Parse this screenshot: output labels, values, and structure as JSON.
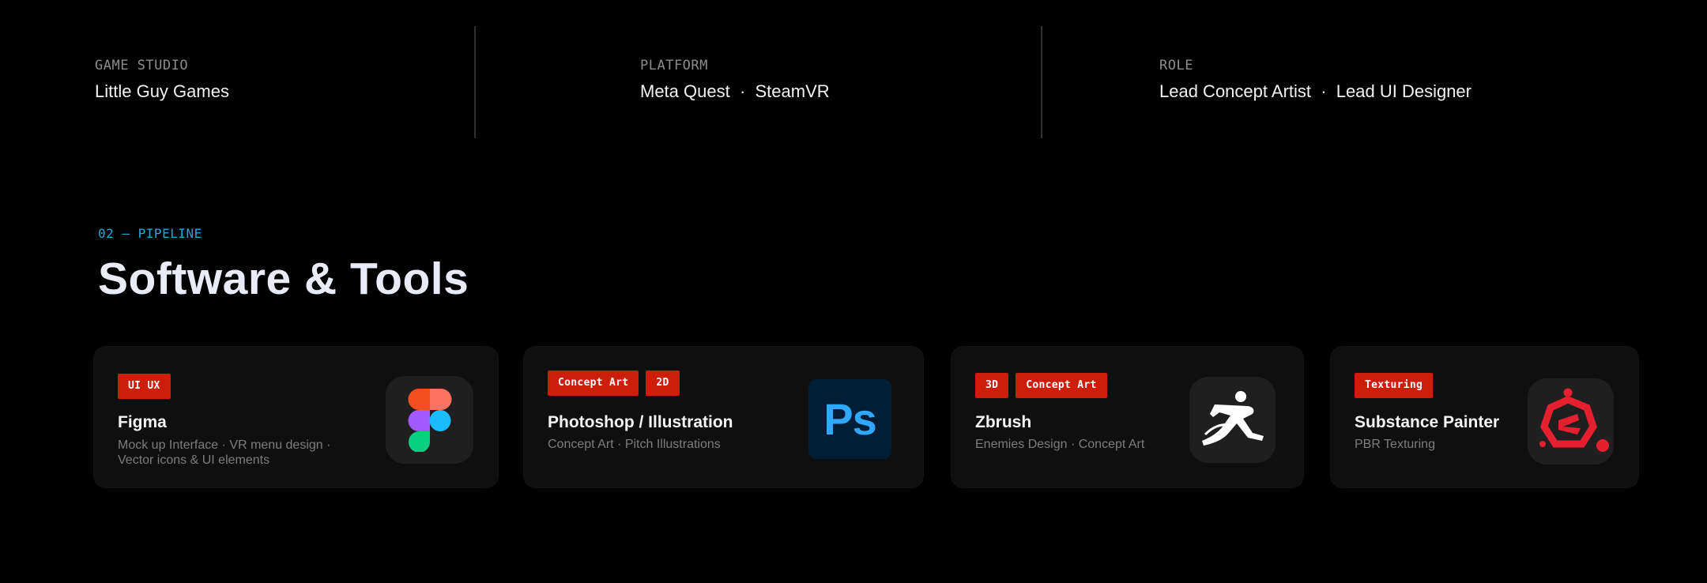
{
  "meta": {
    "studio": {
      "label": "GAME STUDIO",
      "value": "Little Guy Games"
    },
    "platform": {
      "label": "PLATFORM",
      "value": "Meta Quest  ·  SteamVR"
    },
    "role": {
      "label": "ROLE",
      "value": "Lead Concept Artist  ·  Lead UI Designer"
    }
  },
  "section": {
    "tag": "02 — PIPELINE",
    "title": "Software & Tools"
  },
  "tools": [
    {
      "tags": [
        "UI UX"
      ],
      "name": "Figma",
      "desc_line1": "Mock up Interface · VR menu design ·",
      "desc_line2": "Vector icons & UI elements",
      "icon": "figma-icon"
    },
    {
      "tags": [
        "Concept Art",
        "2D"
      ],
      "name": "Photoshop / Illustration",
      "desc": "Concept Art · Pitch Illustrations",
      "icon": "photoshop-icon",
      "icon_text": "Ps"
    },
    {
      "tags": [
        "3D",
        "Concept Art"
      ],
      "name": "Zbrush",
      "desc": "Enemies Design · Concept Art",
      "icon": "zbrush-icon"
    },
    {
      "tags": [
        "Texturing"
      ],
      "name": "Substance Painter",
      "desc": "PBR Texturing",
      "icon": "substance-painter-icon"
    }
  ],
  "colors": {
    "background": "#000000",
    "card": "#0f0f0f",
    "tag": "#cc1e0a",
    "accent": "#22a8d8",
    "title": "#e9ecf6"
  }
}
